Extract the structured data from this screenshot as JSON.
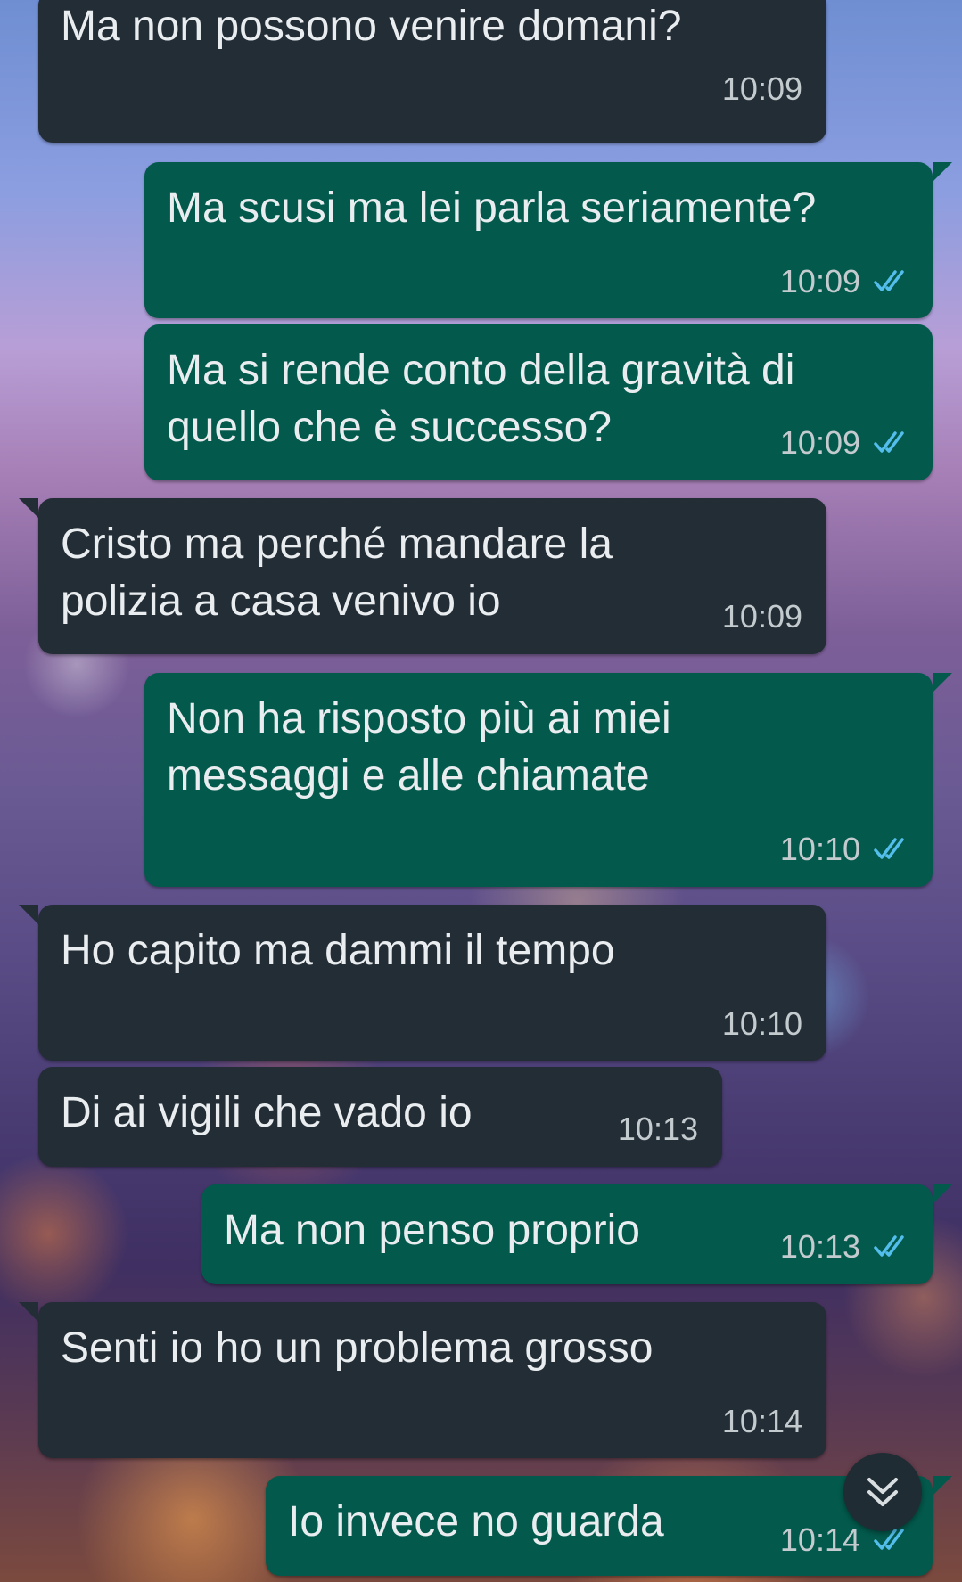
{
  "messages": [
    {
      "text": "Ma non possono venire domani?",
      "time": "10:09",
      "direction": "incoming"
    },
    {
      "text": "Ma scusi ma lei parla seriamente?",
      "time": "10:09",
      "direction": "outgoing",
      "status": "read"
    },
    {
      "text_line1": "Ma si rende conto della gravità di",
      "text_line2": "quello che è successo?",
      "time": "10:09",
      "direction": "outgoing",
      "status": "read"
    },
    {
      "text_line1": "Cristo ma perché mandare la",
      "text_line2": "polizia a casa venivo io",
      "time": "10:09",
      "direction": "incoming"
    },
    {
      "text_line1": "Non ha risposto più ai miei",
      "text_line2": "messaggi e alle chiamate",
      "time": "10:10",
      "direction": "outgoing",
      "status": "read"
    },
    {
      "text": "Ho capito ma dammi il tempo",
      "time": "10:10",
      "direction": "incoming"
    },
    {
      "text": "Di ai vigili che vado io",
      "time": "10:13",
      "direction": "incoming"
    },
    {
      "text": "Ma non penso proprio",
      "time": "10:13",
      "direction": "outgoing",
      "status": "read"
    },
    {
      "text": "Senti io ho un problema grosso",
      "time": "10:14",
      "direction": "incoming"
    },
    {
      "text": "Io invece no guarda",
      "time": "10:14",
      "direction": "outgoing",
      "status": "read"
    }
  ],
  "icons": {
    "read_receipt": "double-check-icon",
    "scroll_down": "chevron-double-down-icon"
  },
  "colors": {
    "incoming_bubble": "#232d36",
    "outgoing_bubble": "#03594c",
    "read_tick": "#53bdeb",
    "message_text": "#e9edef",
    "timestamp": "#c4cbcf"
  }
}
